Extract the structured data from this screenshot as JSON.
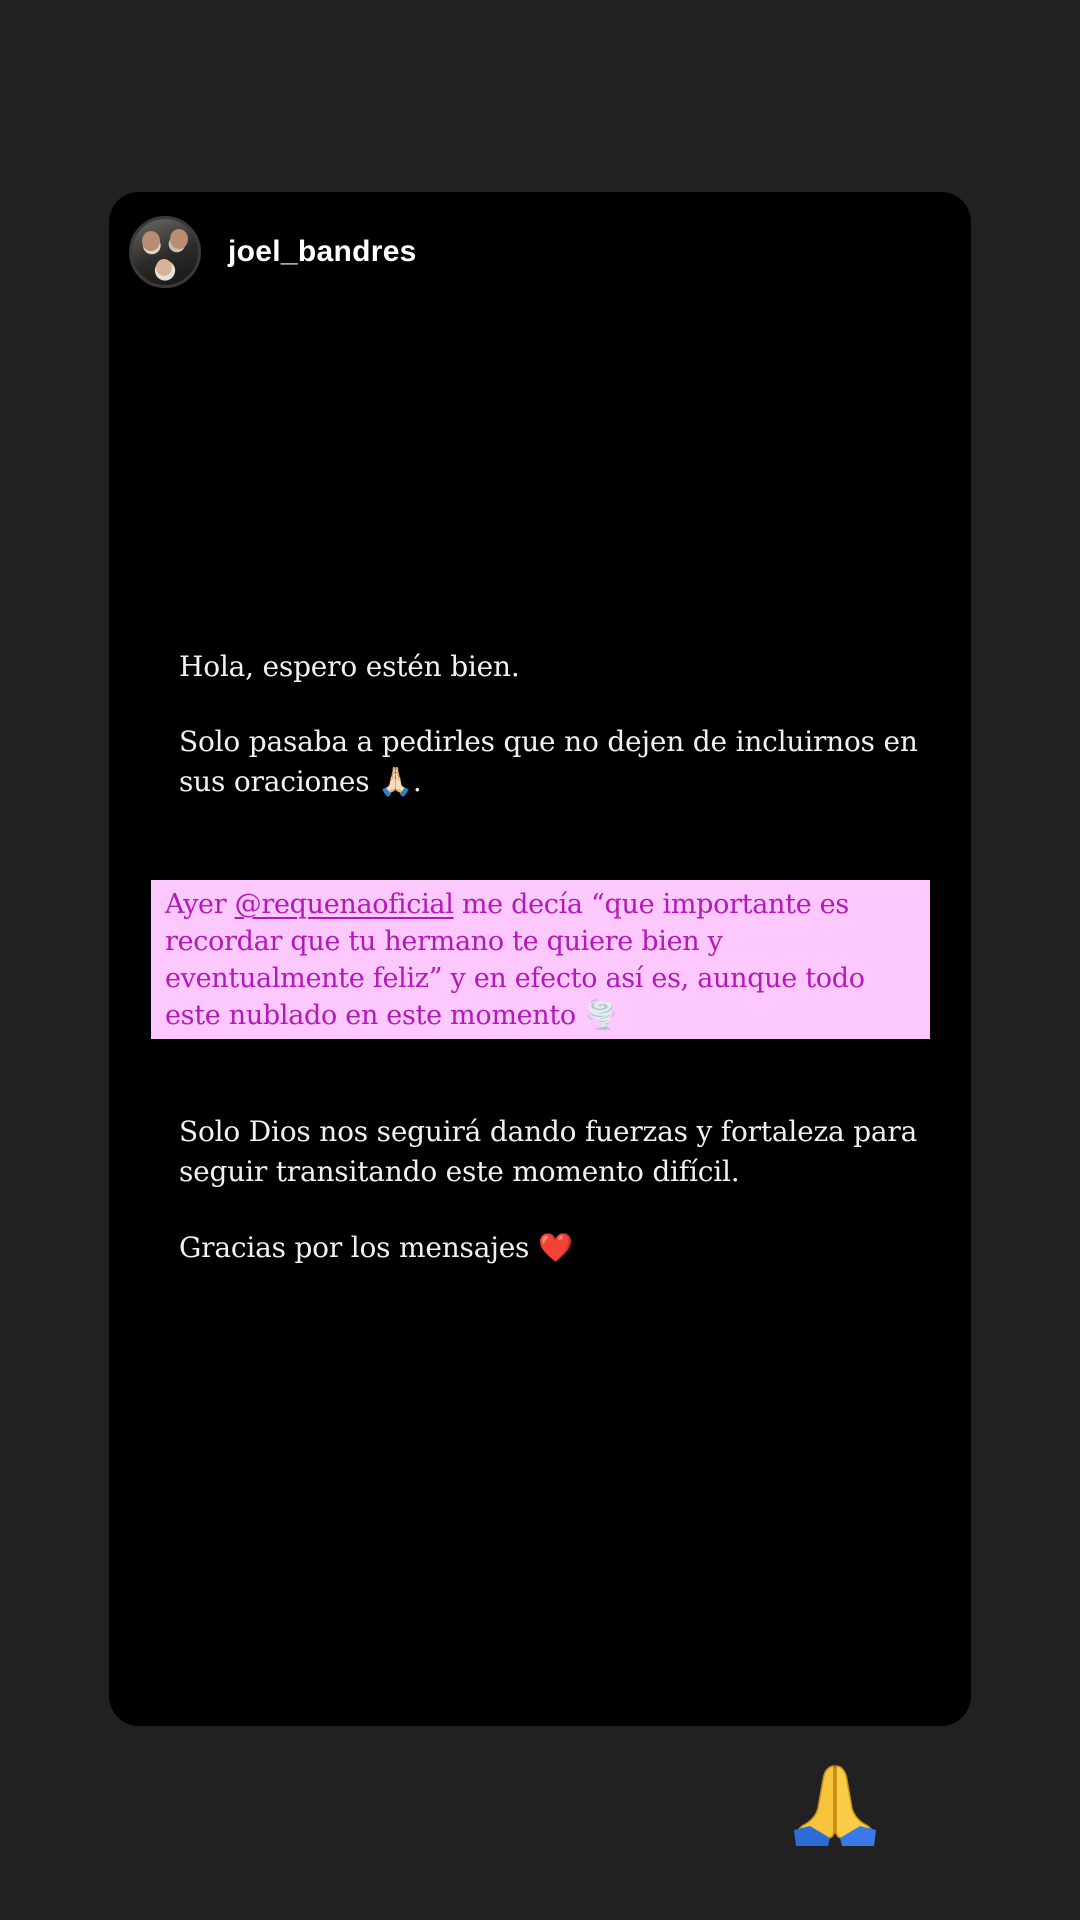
{
  "story": {
    "username": "joel_bandres",
    "paragraph1": "Hola, espero estén bien.",
    "paragraph2": "Solo pasaba a pedirles que no dejen de incluirnos en sus oraciones",
    "paragraph2_emoji": "🙏🏻",
    "paragraph2_end": ".",
    "highlight": {
      "prefix": "Ayer ",
      "mention": "@requenaoficial",
      "body": " me decía “que importante es recordar que tu hermano te quiere bien y eventualmente feliz” y en efecto así es, aunque todo este nublado en este momento ",
      "emoji": "🌪️"
    },
    "paragraph4": "Solo Dios nos seguirá dando fuerzas y fortaleza para seguir transitando este momento difícil.",
    "paragraph5": "Gracias por los mensajes",
    "paragraph5_emoji": "❤️"
  },
  "sticker": {
    "emoji": "🙏"
  },
  "colors": {
    "background": "#212121",
    "card": "#000000",
    "highlight_bg": "#fdc8fd",
    "highlight_text": "#b319b8"
  }
}
